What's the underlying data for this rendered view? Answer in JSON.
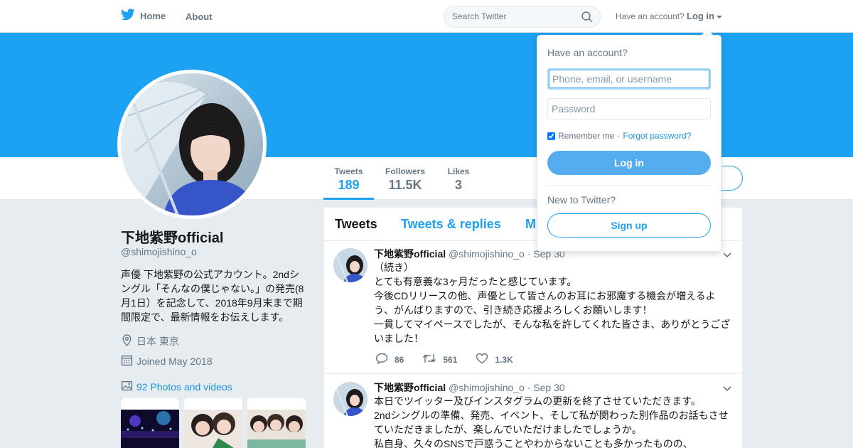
{
  "colors": {
    "brand": "#1da1f2",
    "banner": "#1da1f2",
    "link": "#1b95e0",
    "login_button": "#55acee"
  },
  "nav": {
    "home_label": "Home",
    "about_label": "About",
    "search_placeholder": "Search Twitter",
    "have_account": "Have an account?",
    "login_label": "Log in"
  },
  "profile": {
    "name": "下地紫野official",
    "handle": "@shimojishino_o",
    "bio": "声優 下地紫野の公式アカウント。2ndシングル「そんなの僕じゃない。」の発売(8月1日）を記念して、2018年9月末まで期間限定で、最新情報をお伝えします。",
    "location": "日本 東京",
    "joined": "Joined May 2018",
    "photos": "92 Photos and videos"
  },
  "stats": [
    {
      "label": "Tweets",
      "value": "189"
    },
    {
      "label": "Followers",
      "value": "11.5K"
    },
    {
      "label": "Likes",
      "value": "3"
    }
  ],
  "tabs": [
    "Tweets",
    "Tweets & replies",
    "M"
  ],
  "tweets": [
    {
      "fullname": "下地紫野official",
      "handle": "@shimojishino_o",
      "time": "· Sep 30",
      "lines": [
        "（続き）",
        "とても有意義な3ヶ月だったと感じています。",
        "今後CDリリースの他、声優として皆さんのお耳にお邪魔する機会が増えるよ",
        "う、がんばりますので、引き続き応援よろしくお願いします！",
        "一貫してマイペースでしたが、そんな私を許してくれた皆さま、ありがとうござ",
        "いました！"
      ],
      "replies": "86",
      "retweets": "561",
      "likes": "1.3K"
    },
    {
      "fullname": "下地紫野official",
      "handle": "@shimojishino_o",
      "time": "· Sep 30",
      "lines": [
        "本日でツイッター及びインスタグラムの更新を終了させていただきます。",
        "2ndシングルの準備、発売、イベント、そして私が関わった別作品のお話もさせ",
        "ていただきましたが、楽しんでいただけましたでしょうか。",
        "私自身、久々のSNSで戸惑うことやわからないことも多かったものの、"
      ]
    }
  ],
  "login_dropdown": {
    "title": "Have an account?",
    "username_placeholder": "Phone, email, or username",
    "password_placeholder": "Password",
    "remember_me": "Remember me",
    "separator": "·",
    "forgot_password": "Forgot password?",
    "login_button": "Log in",
    "new_to_twitter": "New to Twitter?",
    "signup_button": "Sign up"
  }
}
